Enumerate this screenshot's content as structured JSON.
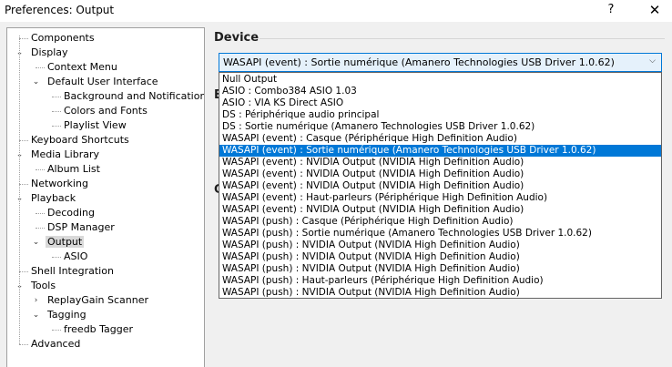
{
  "window": {
    "title": "Preferences: Output",
    "help_glyph": "?",
    "close_glyph": "✕"
  },
  "tree": {
    "items": [
      {
        "label": "Components",
        "level": 0,
        "expanded": null,
        "selected": false
      },
      {
        "label": "Display",
        "level": 0,
        "expanded": true,
        "selected": false
      },
      {
        "label": "Context Menu",
        "level": 1,
        "expanded": null,
        "selected": false
      },
      {
        "label": "Default User Interface",
        "level": 1,
        "expanded": true,
        "selected": false
      },
      {
        "label": "Background and Notifications",
        "level": 2,
        "expanded": null,
        "selected": false
      },
      {
        "label": "Colors and Fonts",
        "level": 2,
        "expanded": null,
        "selected": false
      },
      {
        "label": "Playlist View",
        "level": 2,
        "expanded": null,
        "selected": false
      },
      {
        "label": "Keyboard Shortcuts",
        "level": 0,
        "expanded": null,
        "selected": false
      },
      {
        "label": "Media Library",
        "level": 0,
        "expanded": true,
        "selected": false
      },
      {
        "label": "Album List",
        "level": 1,
        "expanded": null,
        "selected": false
      },
      {
        "label": "Networking",
        "level": 0,
        "expanded": null,
        "selected": false
      },
      {
        "label": "Playback",
        "level": 0,
        "expanded": true,
        "selected": false
      },
      {
        "label": "Decoding",
        "level": 1,
        "expanded": null,
        "selected": false
      },
      {
        "label": "DSP Manager",
        "level": 1,
        "expanded": null,
        "selected": false
      },
      {
        "label": "Output",
        "level": 1,
        "expanded": true,
        "selected": true
      },
      {
        "label": "ASIO",
        "level": 2,
        "expanded": null,
        "selected": false
      },
      {
        "label": "Shell Integration",
        "level": 0,
        "expanded": null,
        "selected": false
      },
      {
        "label": "Tools",
        "level": 0,
        "expanded": true,
        "selected": false
      },
      {
        "label": "ReplayGain Scanner",
        "level": 1,
        "expanded": false,
        "selected": false
      },
      {
        "label": "Tagging",
        "level": 1,
        "expanded": true,
        "selected": false
      },
      {
        "label": "freedb Tagger",
        "level": 2,
        "expanded": null,
        "selected": false
      },
      {
        "label": "Advanced",
        "level": 0,
        "expanded": null,
        "selected": false
      }
    ]
  },
  "device": {
    "section_title": "Device",
    "selected_value": "WASAPI (event) : Sortie numérique (Amanero Technologies USB Driver 1.0.62)",
    "options": [
      "Null Output",
      "ASIO : Combo384 ASIO 1.03",
      "ASIO : VIA KS Direct ASIO",
      "DS : Périphérique audio principal",
      "DS : Sortie numérique (Amanero Technologies USB Driver 1.0.62)",
      "WASAPI (event) : Casque (Périphérique High Definition Audio)",
      "WASAPI (event) : Sortie numérique (Amanero Technologies USB Driver 1.0.62)",
      "WASAPI (event) : NVIDIA Output (NVIDIA High Definition Audio)",
      "WASAPI (event) : NVIDIA Output (NVIDIA High Definition Audio)",
      "WASAPI (event) : NVIDIA Output (NVIDIA High Definition Audio)",
      "WASAPI (event) : Haut-parleurs (Périphérique High Definition Audio)",
      "WASAPI (event) : NVIDIA Output (NVIDIA High Definition Audio)",
      "WASAPI (push) : Casque (Périphérique High Definition Audio)",
      "WASAPI (push) : Sortie numérique (Amanero Technologies USB Driver 1.0.62)",
      "WASAPI (push) : NVIDIA Output (NVIDIA High Definition Audio)",
      "WASAPI (push) : NVIDIA Output (NVIDIA High Definition Audio)",
      "WASAPI (push) : NVIDIA Output (NVIDIA High Definition Audio)",
      "WASAPI (push) : Haut-parleurs (Périphérique High Definition Audio)",
      "WASAPI (push) : NVIDIA Output (NVIDIA High Definition Audio)"
    ],
    "selected_index": 6,
    "hidden_section_letters": [
      "B",
      "C"
    ]
  },
  "colors": {
    "selection": "#0078d7",
    "combo_bg": "#e5f1fb",
    "panel_bg": "#f0f0f0"
  }
}
